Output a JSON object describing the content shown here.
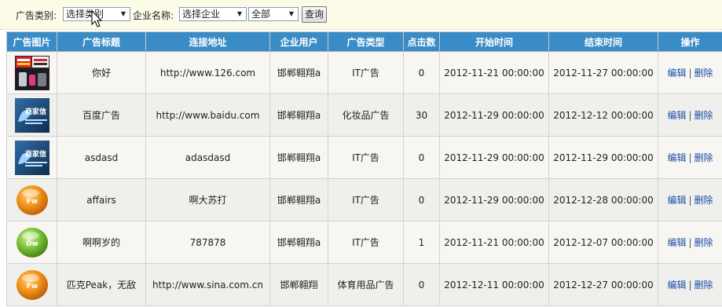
{
  "toolbar": {
    "category_label": "广告类别:",
    "category_value": "选择类别",
    "company_label": "企业名称:",
    "company_value": "选择企业",
    "scope_value": "全部",
    "query_label": "查询"
  },
  "table": {
    "headers": [
      "广告图片",
      "广告标题",
      "连接地址",
      "企业用户",
      "广告类型",
      "点击数",
      "开始时间",
      "结束时间",
      "操作"
    ],
    "edit_label": "编辑",
    "separator": "|",
    "delete_label": "删除",
    "rows": [
      {
        "image": "thumb-collage",
        "title": "你好",
        "url": "http://www.126.com",
        "user": "邯郸翱翔a",
        "type": "IT广告",
        "clicks": "0",
        "start": "2012-11-21 00:00:00",
        "end": "2012-11-27 00:00:00"
      },
      {
        "image": "thumb-shangjia",
        "title": "百度广告",
        "url": "http://www.baidu.com",
        "user": "邯郸翱翔a",
        "type": "化妆品广告",
        "clicks": "30",
        "start": "2012-11-29 00:00:00",
        "end": "2012-12-12 00:00:00"
      },
      {
        "image": "thumb-shangjia",
        "title": "asdasd",
        "url": "adasdasd",
        "user": "邯郸翱翔a",
        "type": "IT广告",
        "clicks": "0",
        "start": "2012-11-29 00:00:00",
        "end": "2012-11-29 00:00:00"
      },
      {
        "image": "thumb-fw",
        "title": "affairs",
        "url": "啊大苏打",
        "user": "邯郸翱翔a",
        "type": "IT广告",
        "clicks": "0",
        "start": "2012-11-29 00:00:00",
        "end": "2012-12-28 00:00:00"
      },
      {
        "image": "thumb-dw",
        "title": "啊啊岁的",
        "url": "787878",
        "user": "邯郸翱翔a",
        "type": "IT广告",
        "clicks": "1",
        "start": "2012-11-21 00:00:00",
        "end": "2012-12-07 00:00:00"
      },
      {
        "image": "thumb-fw",
        "title": "匹克Peak，无敌",
        "url": "http://www.sina.com.cn",
        "user": "邯郸翱翔",
        "type": "体育用品广告",
        "clicks": "0",
        "start": "2012-12-11 00:00:00",
        "end": "2012-12-27 00:00:00"
      }
    ]
  },
  "thumb_text": {
    "shangjia": "商家信",
    "fw": "Fw",
    "dw": "Dw"
  },
  "colors": {
    "header_bg": "#3a8cc6",
    "link": "#1a4ea6",
    "fw_orange": "#f2941c",
    "dw_green": "#7cc23a"
  }
}
